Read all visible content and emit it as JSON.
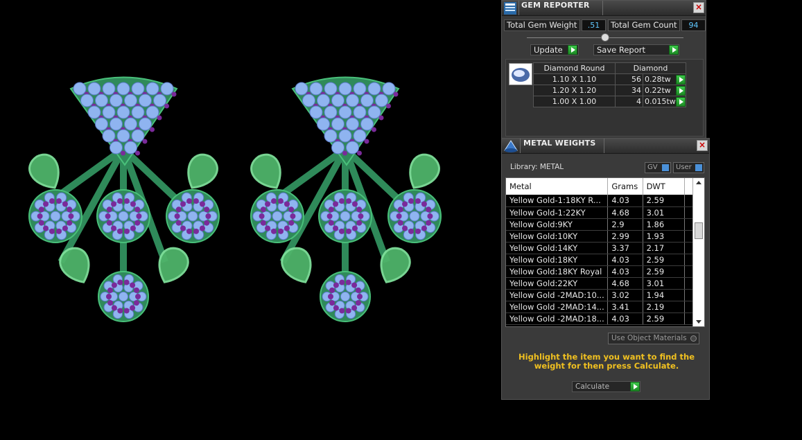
{
  "gem_reporter": {
    "title": "GEM REPORTER",
    "total_gem_weight_label": "Total Gem Weight",
    "total_gem_weight_value": ".51",
    "total_gem_count_label": "Total Gem Count",
    "total_gem_count_value": "94",
    "update_label": "Update",
    "save_report_label": "Save Report",
    "table_headers": [
      "Diamond Round",
      "Diamond"
    ],
    "rows": [
      {
        "size": "1.10 X 1.10",
        "count": "56",
        "weight": "0.28tw"
      },
      {
        "size": "1.20 X 1.20",
        "count": "34",
        "weight": "0.22tw"
      },
      {
        "size": "1.00 X 1.00",
        "count": "4",
        "weight": "0.015tw"
      }
    ]
  },
  "metal_weights": {
    "title": "METAL WEIGHTS",
    "library_label": "Library: METAL",
    "gv_label": "GV",
    "user_label": "User",
    "columns": [
      "Metal",
      "Grams",
      "DWT"
    ],
    "rows": [
      {
        "metal": "Yellow Gold-1:18KY R...",
        "grams": "4.03",
        "dwt": "2.59"
      },
      {
        "metal": "Yellow Gold-1:22KY",
        "grams": "4.68",
        "dwt": "3.01"
      },
      {
        "metal": "Yellow Gold:9KY",
        "grams": "2.9",
        "dwt": "1.86"
      },
      {
        "metal": "Yellow Gold:10KY",
        "grams": "2.99",
        "dwt": "1.93"
      },
      {
        "metal": "Yellow Gold:14KY",
        "grams": "3.37",
        "dwt": "2.17"
      },
      {
        "metal": "Yellow Gold:18KY",
        "grams": "4.03",
        "dwt": "2.59"
      },
      {
        "metal": "Yellow Gold:18KY Royal",
        "grams": "4.03",
        "dwt": "2.59"
      },
      {
        "metal": "Yellow Gold:22KY",
        "grams": "4.68",
        "dwt": "3.01"
      },
      {
        "metal": "Yellow Gold -2MAD:10...",
        "grams": "3.02",
        "dwt": "1.94"
      },
      {
        "metal": "Yellow Gold -2MAD:14...",
        "grams": "3.41",
        "dwt": "2.19"
      },
      {
        "metal": "Yellow Gold -2MAD:18...",
        "grams": "4.03",
        "dwt": "2.59"
      }
    ],
    "use_object_materials_label": "Use Object Materials",
    "instruction": "Highlight the item you want to find the weight for then press Calculate.",
    "calculate_label": "Calculate"
  },
  "colors": {
    "accent_value": "#60c8ff",
    "go_green": "#2aa834",
    "instruction_yellow": "#f0c020",
    "gem_blue": "#8fb4f0",
    "gem_purple": "#7a2a9a",
    "metal_green": "#2f8a5a"
  }
}
